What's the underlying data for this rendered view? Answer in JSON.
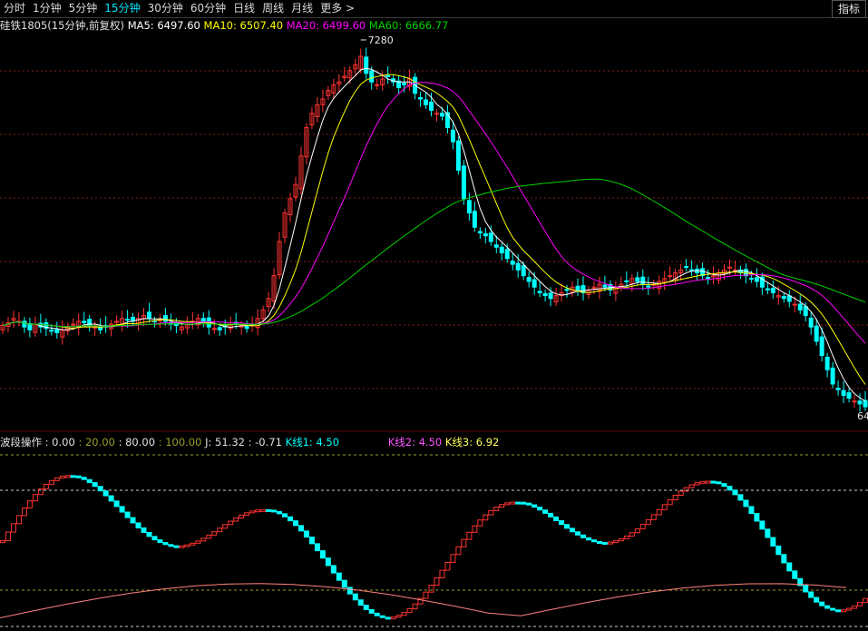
{
  "toolbar": {
    "tabs": [
      "分时",
      "1分钟",
      "5分钟",
      "15分钟",
      "30分钟",
      "60分钟",
      "日线",
      "周线",
      "月线",
      "更多 >"
    ],
    "active_tab": "15分钟",
    "indicator_button": "指标"
  },
  "main_panel": {
    "title": "硅铁1805(15分钟,前复权)",
    "ma5": "MA5: 6497.60",
    "ma10": "MA10: 6507.40",
    "ma20": "MA20: 6499.60",
    "ma60": "MA60: 6666.77",
    "high_label": "7280",
    "low_label": "64"
  },
  "sub_panel": {
    "title": "波段操作",
    "levels": [
      ": 0.00",
      ": 20.00",
      ": 80.00",
      ": 100.00"
    ],
    "j_label": "J: 51.32",
    "j_change": ": -0.71",
    "k1": "K线1: 4.50",
    "k2": "K线2: 4.50",
    "k3": "K线3: 6.92"
  },
  "colors": {
    "up": "#ff3232",
    "down": "#00ffff",
    "ma5": "#ffffff",
    "ma10": "#ffff00",
    "ma20": "#ff00ff",
    "ma60": "#00d000",
    "grid": "#8a1a1a",
    "active_tab": "#00e5ff"
  },
  "chart_data": {
    "type": "candlestick",
    "x_count": 160,
    "price_range": [
      6400,
      7300
    ],
    "close_series": [
      6305,
      6315,
      6330,
      6320,
      6300,
      6290,
      6310,
      6300,
      6295,
      6285,
      6280,
      6290,
      6300,
      6310,
      6320,
      6315,
      6305,
      6300,
      6290,
      6300,
      6310,
      6320,
      6330,
      6325,
      6320,
      6330,
      6340,
      6330,
      6320,
      6325,
      6320,
      6310,
      6305,
      6300,
      6310,
      6320,
      6330,
      6320,
      6300,
      6295,
      6290,
      6300,
      6310,
      6315,
      6305,
      6295,
      6310,
      6330,
      6360,
      6400,
      6480,
      6600,
      6700,
      6750,
      6800,
      6900,
      7000,
      7050,
      7080,
      7100,
      7130,
      7150,
      7160,
      7180,
      7200,
      7220,
      7250,
      7190,
      7160,
      7150,
      7170,
      7180,
      7160,
      7140,
      7150,
      7170,
      7120,
      7100,
      7080,
      7060,
      7050,
      7040,
      7000,
      6950,
      6850,
      6750,
      6700,
      6650,
      6630,
      6620,
      6600,
      6580,
      6560,
      6540,
      6520,
      6500,
      6480,
      6460,
      6440,
      6420,
      6410,
      6400,
      6410,
      6420,
      6430,
      6440,
      6430,
      6420,
      6430,
      6440,
      6450,
      6440,
      6430,
      6440,
      6450,
      6460,
      6470,
      6460,
      6450,
      6440,
      6450,
      6460,
      6470,
      6480,
      6490,
      6500,
      6510,
      6500,
      6490,
      6480,
      6470,
      6480,
      6490,
      6500,
      6510,
      6500,
      6490,
      6480,
      6470,
      6460,
      6440,
      6430,
      6420,
      6410,
      6400,
      6390,
      6380,
      6360,
      6340,
      6300,
      6250,
      6200,
      6150,
      6100,
      6080,
      6060,
      6050,
      6040,
      6030,
      6020
    ],
    "sub_levels": [
      0,
      20,
      80,
      100
    ]
  }
}
